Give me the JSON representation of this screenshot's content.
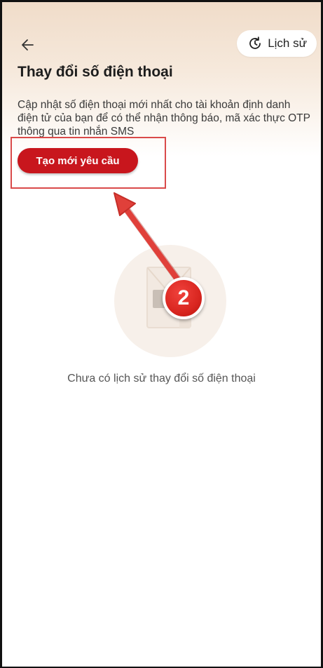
{
  "header": {
    "back_icon": "arrow-left-icon",
    "history_icon": "history-clock-icon",
    "history_label": "Lịch sử",
    "title": "Thay đổi số điện thoại"
  },
  "main": {
    "description": "Cập nhật số điện thoại mới nhất cho tài khoản định danh điện tử của bạn để có thể nhận thông báo, mã xác thực OTP thông qua tin nhắn SMS",
    "create_button_label": "Tạo mới yêu cầu",
    "empty_state_icon": "document-icon",
    "empty_state_text": "Chưa có lịch sử thay đổi số điện thoại"
  },
  "annotation": {
    "step_number": "2",
    "color": "#d93a34"
  },
  "colors": {
    "primary": "#c8161d",
    "header_gradient_top": "#f0dcc9",
    "text_dark": "#1d1d1d"
  }
}
